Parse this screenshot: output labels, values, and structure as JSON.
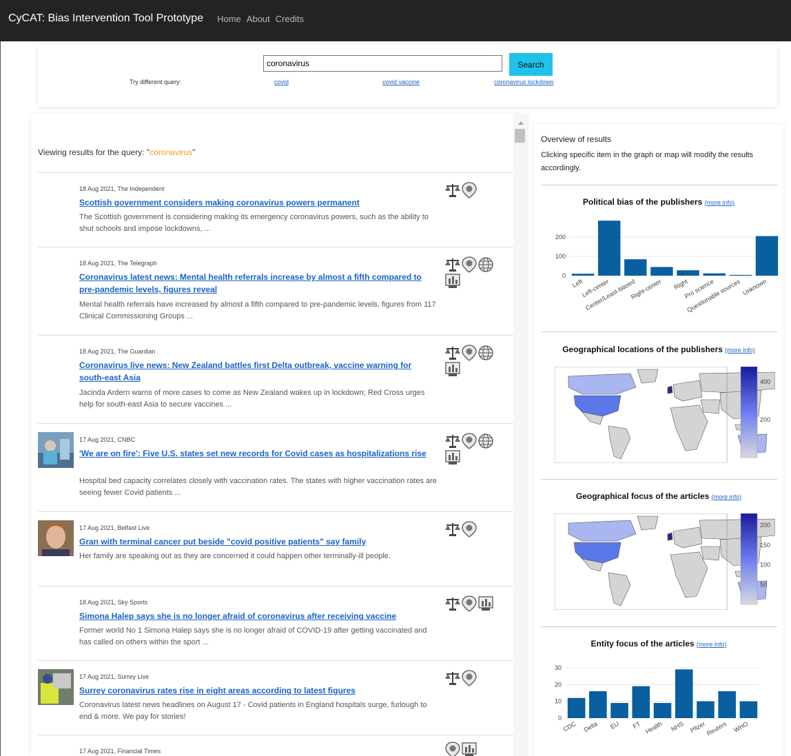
{
  "app": {
    "title": "CyCAT: Bias Intervention Tool Prototype",
    "nav": [
      "Home",
      "About",
      "Credits"
    ]
  },
  "search": {
    "value": "coronavirus",
    "button": "Search",
    "try_label": "Try different query:",
    "alternatives": [
      "covid",
      "covid vaccine",
      "coronavirus lockdown"
    ]
  },
  "results": {
    "query_prefix": "Viewing results for the query: \"",
    "query": "coronavirus",
    "query_suffix": "\"",
    "items": [
      {
        "meta": "18 Aug 2021, The Independent",
        "title": "Scottish government considers making coronavirus powers permanent",
        "snippet": "The Scottish government is considering making its emergency coronavirus powers, such as the ability to shut schools and impose lockdowns, ...",
        "icons": [
          "scales-icon",
          "location-pin-icon"
        ]
      },
      {
        "meta": "18 Aug 2021, The Telegraph",
        "title": "Coronavirus latest news: Mental health referrals increase by almost a fifth compared to pre-pandemic levels, figures reveal",
        "snippet": "Mental health referrals have increased by almost a fifth compared to pre-pandemic levels, figures from 117 Clinical Commissioning Groups ...",
        "icons": [
          "scales-icon",
          "location-pin-icon",
          "globe-icon",
          "building-icon"
        ]
      },
      {
        "meta": "18 Aug 2021, The Guardian",
        "title": "Coronavirus live news: New Zealand battles first Delta outbreak, vaccine warning for south-east Asia",
        "snippet": "Jacinda Ardern warns of more cases to come as New Zealand wakes up in lockdown; Red Cross urges help for south-east Asia to secure vaccines ...",
        "icons": [
          "scales-icon",
          "location-pin-icon",
          "globe-icon",
          "building-icon"
        ]
      },
      {
        "meta": "17 Aug 2021, CNBC",
        "title": "'We are on fire': Five U.S. states set new records for Covid cases as hospitalizations rise",
        "snippet": "Hospital bed capacity correlates closely with vaccination rates. The states with higher vaccination rates are seeing fewer Covid patients ...",
        "icons": [
          "scales-icon",
          "location-pin-icon",
          "globe-icon",
          "building-icon"
        ]
      },
      {
        "meta": "17 Aug 2021, Belfast Live",
        "title": "Gran with terminal cancer put beside \"covid positive patients\" say family",
        "snippet": "Her family are speaking out as they are concerned it could happen other terminally-ill people.",
        "icons": [
          "scales-icon",
          "location-pin-icon"
        ]
      },
      {
        "meta": "18 Aug 2021, Sky Sports",
        "title": "Simona Halep says she is no longer afraid of coronavirus after receiving vaccine",
        "snippet": "Former world No 1 Simona Halep says she is no longer afraid of COVID-19 after getting vaccinated and has called on others within the sport ...",
        "icons": [
          "scales-icon",
          "location-pin-icon",
          "building-icon"
        ]
      },
      {
        "meta": "17 Aug 2021, Surrey Live",
        "title": "Surrey coronavirus rates rise in eight areas according to latest figures",
        "snippet": "Coronavirus latest news headlines on August 17 - Covid patients in England hospitals surge, furlough to end & more. We pay for stories!",
        "icons": [
          "scales-icon",
          "location-pin-icon"
        ]
      },
      {
        "meta": "17 Aug 2021, Financial Times",
        "title": "",
        "snippet": "",
        "icons": [
          "location-pin-icon",
          "building-icon"
        ]
      }
    ]
  },
  "overview": {
    "title": "Overview of results",
    "description": "Clicking specific item in the graph or map will modify the results accordingly.",
    "more_info": "(more info)"
  },
  "chart_data": [
    {
      "type": "bar",
      "title": "Political bias of the publishers",
      "categories": [
        "Left",
        "Left-center",
        "Center/Least-biased",
        "Right-center",
        "Right",
        "Pro science",
        "Questionable sources",
        "Unknown"
      ],
      "values": [
        10,
        285,
        85,
        45,
        28,
        12,
        4,
        205
      ],
      "yticks": [
        0,
        100,
        200
      ],
      "ylim": [
        0,
        300
      ],
      "color": "#0a5fa0"
    },
    {
      "type": "heatmap",
      "title": "Geographical locations of the publishers",
      "colorbar_ticks": [
        200,
        400
      ],
      "color_range": [
        0,
        480
      ],
      "highlighted": [
        "United States",
        "United Kingdom",
        "Canada",
        "Australia"
      ],
      "colors": {
        "high": "#1a1a9c",
        "low": "#d8d8e0",
        "land": "#d4d4d4"
      }
    },
    {
      "type": "heatmap",
      "title": "Geographical focus of the articles",
      "colorbar_ticks": [
        50,
        100,
        150,
        200
      ],
      "color_range": [
        0,
        230
      ],
      "highlighted": [
        "United States",
        "United Kingdom",
        "Canada",
        "Australia"
      ],
      "colors": {
        "high": "#1a1a9c",
        "low": "#d8d8e0",
        "land": "#d4d4d4"
      }
    },
    {
      "type": "bar",
      "title": "Entity focus of the articles",
      "categories": [
        "CDC",
        "Delta",
        "EU",
        "FT",
        "Health",
        "NHS",
        "Pfizer",
        "Reuters",
        "WHO"
      ],
      "values": [
        12,
        16,
        9,
        19,
        9,
        29,
        10,
        16,
        10
      ],
      "yticks": [
        0,
        10,
        20,
        30
      ],
      "ylim": [
        0,
        32
      ],
      "color": "#0a5fa0"
    }
  ]
}
